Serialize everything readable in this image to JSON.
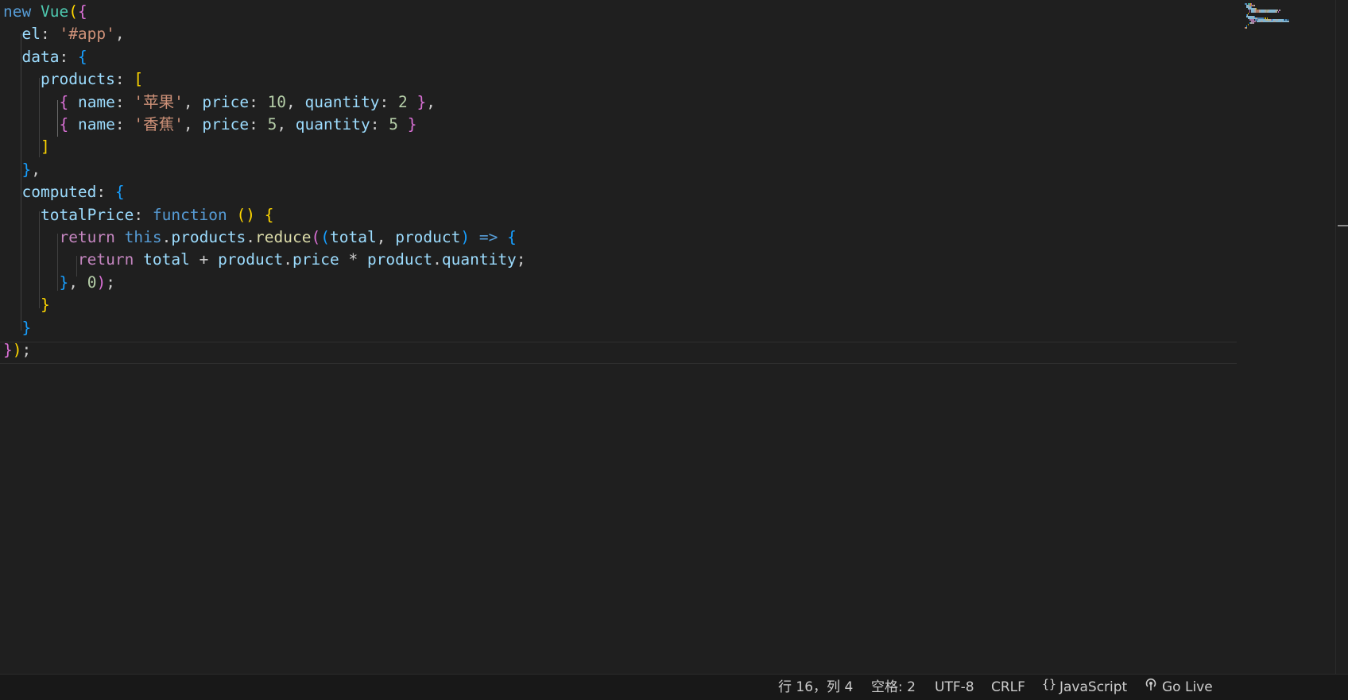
{
  "editor": {
    "language_id": "javascript",
    "lines": [
      [
        [
          "kw",
          "new"
        ],
        [
          "pun",
          " "
        ],
        [
          "cls",
          "Vue"
        ],
        [
          "b1",
          "("
        ],
        [
          "b2",
          "{"
        ]
      ],
      [
        [
          "pun",
          "  "
        ],
        [
          "var",
          "el"
        ],
        [
          "pun",
          ": "
        ],
        [
          "str",
          "'#app'"
        ],
        [
          "pun",
          ","
        ]
      ],
      [
        [
          "pun",
          "  "
        ],
        [
          "var",
          "data"
        ],
        [
          "pun",
          ": "
        ],
        [
          "b3",
          "{"
        ]
      ],
      [
        [
          "pun",
          "    "
        ],
        [
          "var",
          "products"
        ],
        [
          "pun",
          ": "
        ],
        [
          "b1",
          "["
        ]
      ],
      [
        [
          "pun",
          "      "
        ],
        [
          "b2",
          "{"
        ],
        [
          "pun",
          " "
        ],
        [
          "var",
          "name"
        ],
        [
          "pun",
          ": "
        ],
        [
          "str",
          "'苹果'"
        ],
        [
          "pun",
          ", "
        ],
        [
          "var",
          "price"
        ],
        [
          "pun",
          ": "
        ],
        [
          "num",
          "10"
        ],
        [
          "pun",
          ", "
        ],
        [
          "var",
          "quantity"
        ],
        [
          "pun",
          ": "
        ],
        [
          "num",
          "2"
        ],
        [
          "pun",
          " "
        ],
        [
          "b2",
          "}"
        ],
        [
          "pun",
          ","
        ]
      ],
      [
        [
          "pun",
          "      "
        ],
        [
          "b2",
          "{"
        ],
        [
          "pun",
          " "
        ],
        [
          "var",
          "name"
        ],
        [
          "pun",
          ": "
        ],
        [
          "str",
          "'香蕉'"
        ],
        [
          "pun",
          ", "
        ],
        [
          "var",
          "price"
        ],
        [
          "pun",
          ": "
        ],
        [
          "num",
          "5"
        ],
        [
          "pun",
          ", "
        ],
        [
          "var",
          "quantity"
        ],
        [
          "pun",
          ": "
        ],
        [
          "num",
          "5"
        ],
        [
          "pun",
          " "
        ],
        [
          "b2",
          "}"
        ]
      ],
      [
        [
          "pun",
          "    "
        ],
        [
          "b1",
          "]"
        ]
      ],
      [
        [
          "pun",
          "  "
        ],
        [
          "b3",
          "}"
        ],
        [
          "pun",
          ","
        ]
      ],
      [
        [
          "pun",
          "  "
        ],
        [
          "var",
          "computed"
        ],
        [
          "pun",
          ": "
        ],
        [
          "b3",
          "{"
        ]
      ],
      [
        [
          "pun",
          "    "
        ],
        [
          "var",
          "totalPrice"
        ],
        [
          "pun",
          ": "
        ],
        [
          "kw",
          "function"
        ],
        [
          "pun",
          " "
        ],
        [
          "b1",
          "()"
        ],
        [
          "pun",
          " "
        ],
        [
          "b1",
          "{"
        ]
      ],
      [
        [
          "pun",
          "      "
        ],
        [
          "ctl",
          "return"
        ],
        [
          "pun",
          " "
        ],
        [
          "kw",
          "this"
        ],
        [
          "pun",
          "."
        ],
        [
          "var",
          "products"
        ],
        [
          "pun",
          "."
        ],
        [
          "fn",
          "reduce"
        ],
        [
          "b2",
          "("
        ],
        [
          "b3",
          "("
        ],
        [
          "var",
          "total"
        ],
        [
          "pun",
          ", "
        ],
        [
          "var",
          "product"
        ],
        [
          "b3",
          ")"
        ],
        [
          "pun",
          " "
        ],
        [
          "kw",
          "=>"
        ],
        [
          "pun",
          " "
        ],
        [
          "b3",
          "{"
        ]
      ],
      [
        [
          "pun",
          "        "
        ],
        [
          "ctl",
          "return"
        ],
        [
          "pun",
          " "
        ],
        [
          "var",
          "total"
        ],
        [
          "pun",
          " + "
        ],
        [
          "var",
          "product"
        ],
        [
          "pun",
          "."
        ],
        [
          "var",
          "price"
        ],
        [
          "pun",
          " * "
        ],
        [
          "var",
          "product"
        ],
        [
          "pun",
          "."
        ],
        [
          "var",
          "quantity"
        ],
        [
          "pun",
          ";"
        ]
      ],
      [
        [
          "pun",
          "      "
        ],
        [
          "b3",
          "}"
        ],
        [
          "pun",
          ", "
        ],
        [
          "num",
          "0"
        ],
        [
          "b2",
          ")"
        ],
        [
          "pun",
          ";"
        ]
      ],
      [
        [
          "pun",
          "    "
        ],
        [
          "b1",
          "}"
        ]
      ],
      [
        [
          "pun",
          "  "
        ],
        [
          "b3",
          "}"
        ]
      ],
      [
        [
          "b2",
          "}"
        ],
        [
          "b1",
          ")"
        ],
        [
          "pun",
          ";"
        ]
      ]
    ]
  },
  "statusbar": {
    "cursor": "行 16，列 4",
    "indent": "空格: 2",
    "encoding": "UTF-8",
    "eol": "CRLF",
    "language": "JavaScript",
    "golive": "Go Live"
  },
  "icons": {
    "language": "braces-icon",
    "golive": "broadcast-icon"
  },
  "colors": {
    "background": "#1f1f1f",
    "keyword": "#569cd6",
    "control": "#c586c0",
    "class": "#4ec9b0",
    "function": "#dcdcaa",
    "variable": "#9cdcfe",
    "string": "#ce9178",
    "number": "#b5cea8",
    "bracket1": "#ffd700",
    "bracket2": "#da70d6",
    "bracket3": "#179fff"
  }
}
